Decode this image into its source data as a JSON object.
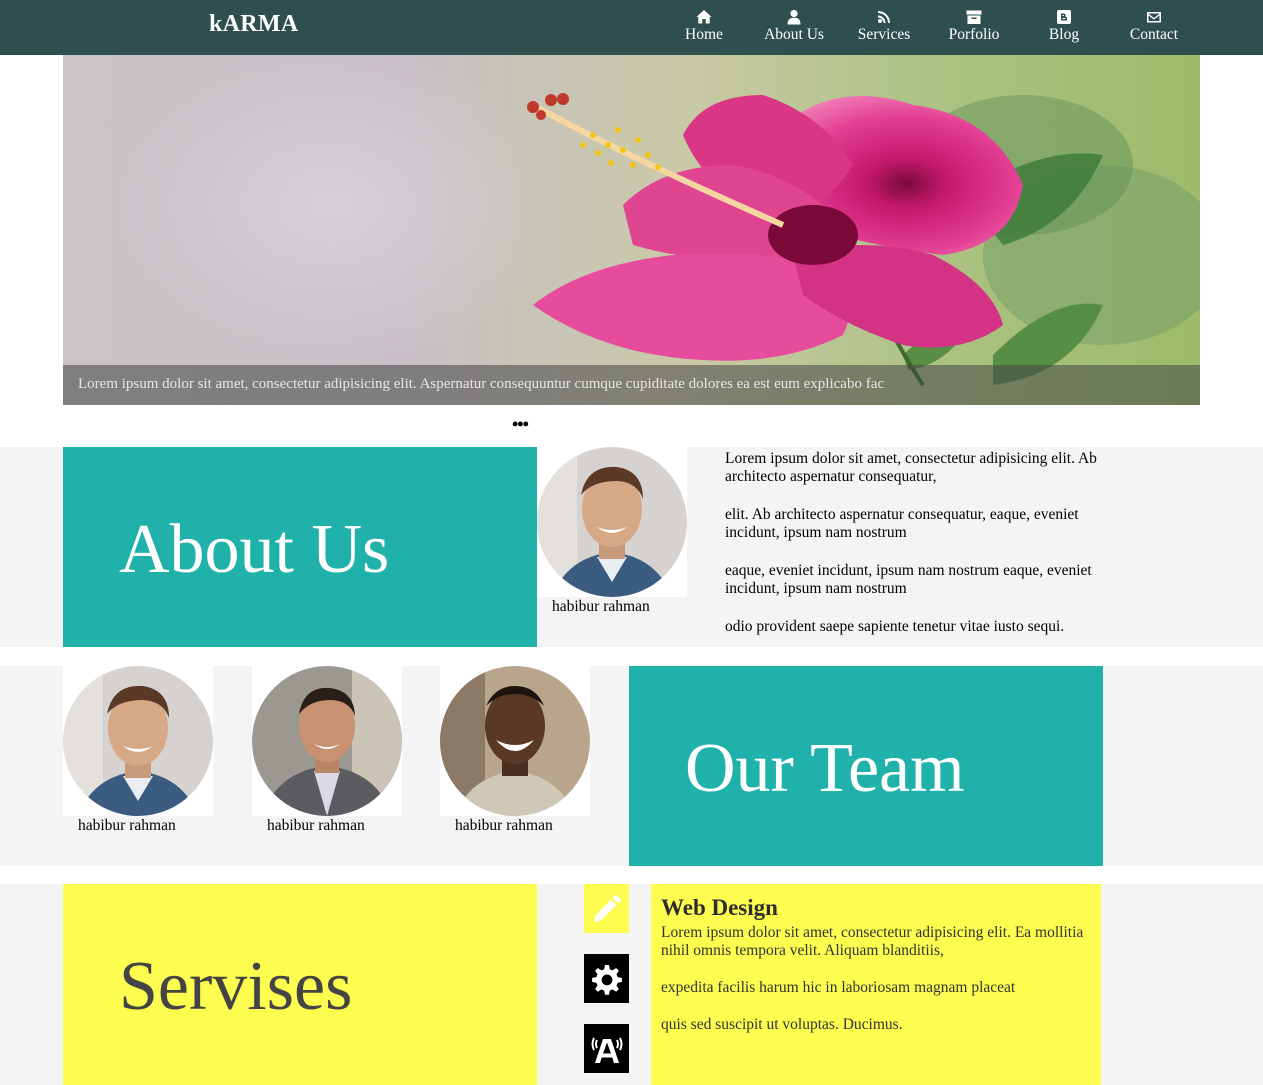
{
  "brand": "kARMA",
  "nav": [
    {
      "label": "Home",
      "icon": "home-icon"
    },
    {
      "label": "About Us",
      "icon": "user-icon"
    },
    {
      "label": "Services",
      "icon": "feed-icon"
    },
    {
      "label": "Porfolio",
      "icon": "archive-icon"
    },
    {
      "label": "Blog",
      "icon": "blogger-icon"
    },
    {
      "label": "Contact",
      "icon": "envelope-icon"
    }
  ],
  "hero": {
    "caption": "Lorem ipsum dolor sit amet, consectetur adipisicing elit. Aspernatur consequuntur cumque cupiditate dolores ea est eum explicabo fac",
    "dots": "•••"
  },
  "about": {
    "title": "About Us",
    "person": "habibur rahman",
    "paragraphs": [
      "Lorem ipsum dolor sit amet, consectetur adipisicing elit. Ab architecto aspernatur consequatur,",
      "elit. Ab architecto aspernatur consequatur, eaque, eveniet incidunt, ipsum nam nostrum",
      "eaque, eveniet incidunt, ipsum nam nostrum eaque, eveniet incidunt, ipsum nam nostrum",
      "odio provident saepe sapiente tenetur vitae iusto sequi."
    ]
  },
  "team": {
    "title": "Our Team",
    "members": [
      {
        "name": "habibur rahman"
      },
      {
        "name": "habibur rahman"
      },
      {
        "name": "habibur rahman"
      }
    ]
  },
  "services": {
    "title": "Servises",
    "icons": [
      "pencil-icon",
      "gear-icon",
      "accessibility-icon"
    ],
    "item_title": "Web Design",
    "paragraphs": [
      "Lorem ipsum dolor sit amet, consectetur adipisicing elit. Ea mollitia nihil omnis tempora velit. Aliquam blanditiis,",
      "expedita facilis harum hic in laboriosam magnam placeat",
      "quis sed suscipit ut voluptas. Ducimus."
    ]
  },
  "colors": {
    "navbar": "#2f4f4f",
    "teal": "#20b2aa",
    "yellow": "#fdfd4f",
    "band": "#f4f4f4"
  }
}
